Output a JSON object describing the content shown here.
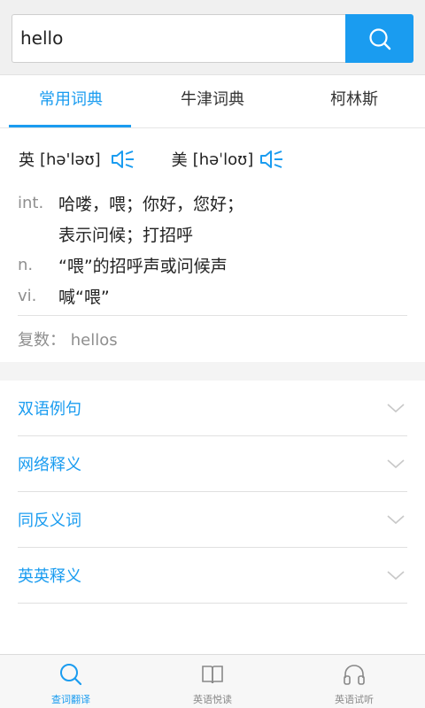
{
  "search": {
    "value": "hello",
    "button_icon": "search-icon"
  },
  "tabs": [
    {
      "label": "常用词典",
      "active": true
    },
    {
      "label": "牛津词典",
      "active": false
    },
    {
      "label": "柯林斯",
      "active": false
    }
  ],
  "phonetics": {
    "uk": {
      "label": "英",
      "ipa": "[hə'ləʊ]",
      "icon": "speaker-icon"
    },
    "us": {
      "label": "美",
      "ipa": "[həˈloʊ]",
      "icon": "speaker-icon"
    }
  },
  "definitions": [
    {
      "pos": "int.",
      "text": "哈喽，喂；你好，您好；"
    },
    {
      "pos": "",
      "text": "表示问候；打招呼"
    },
    {
      "pos": "n.",
      "text": "“喂”的招呼声或问候声"
    },
    {
      "pos": "vi.",
      "text": "喊“喂”"
    }
  ],
  "plural": "复数： hellos",
  "sections": [
    {
      "label": "双语例句",
      "icon": "chevron-down-icon"
    },
    {
      "label": "网络释义",
      "icon": "chevron-down-icon"
    },
    {
      "label": "同反义词",
      "icon": "chevron-down-icon"
    },
    {
      "label": "英英释义",
      "icon": "chevron-down-icon"
    }
  ],
  "bottom_nav": [
    {
      "label": "查词翻译",
      "icon": "search-icon",
      "active": true
    },
    {
      "label": "英语悦读",
      "icon": "book-icon",
      "active": false
    },
    {
      "label": "英语试听",
      "icon": "headphones-icon",
      "active": false
    }
  ],
  "colors": {
    "accent": "#1a9cf0",
    "muted": "#8f8f8f"
  }
}
